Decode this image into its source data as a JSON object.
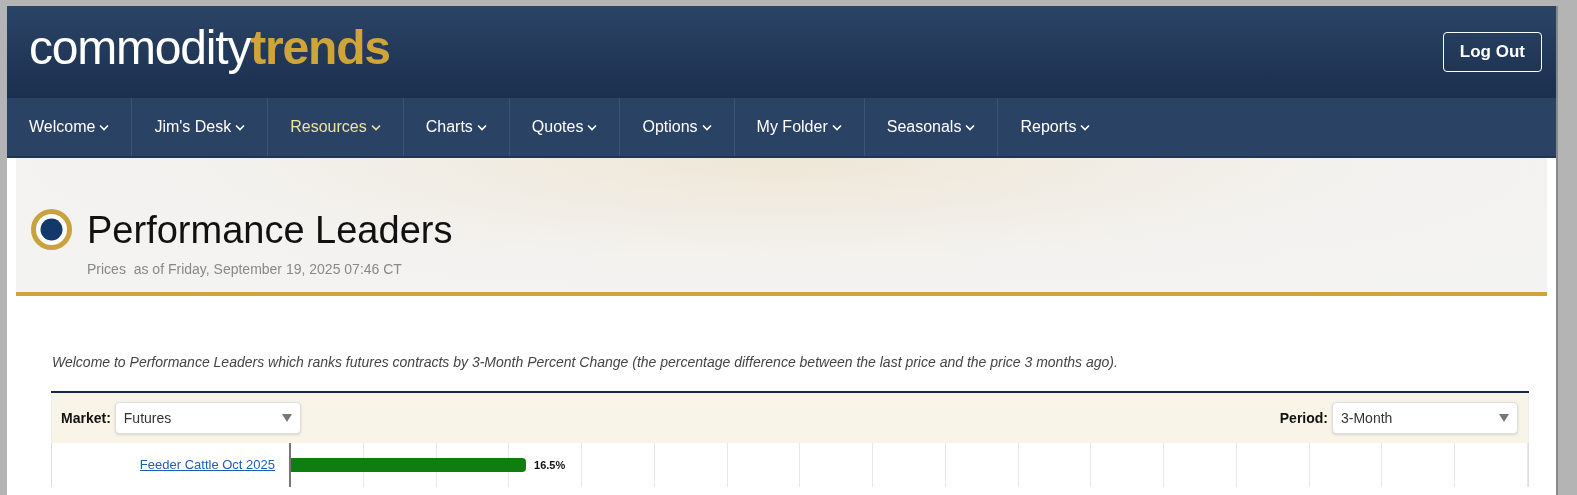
{
  "header": {
    "logo": {
      "part_1": "commodity",
      "part_2": "trends"
    },
    "logout_button": "Log Out"
  },
  "nav": [
    {
      "label": "Welcome",
      "selected": false
    },
    {
      "label": "Jim's Desk",
      "selected": false
    },
    {
      "label": "Resources",
      "selected": true
    },
    {
      "label": "Charts",
      "selected": false
    },
    {
      "label": "Quotes",
      "selected": false
    },
    {
      "label": "Options",
      "selected": false
    },
    {
      "label": "My Folder",
      "selected": false
    },
    {
      "label": "Seasonals",
      "selected": false
    },
    {
      "label": "Reports",
      "selected": false
    }
  ],
  "page": {
    "title": "Performance Leaders",
    "subtitle": "Prices  as of Friday, September 19, 2025 07:46 CT",
    "intro": "Welcome to Performance Leaders which ranks futures contracts by 3-Month Percent Change (the percentage difference between the last price and the price 3 months ago)."
  },
  "filters": {
    "market": {
      "label": "Market:",
      "value": "Futures"
    },
    "period": {
      "label": "Period:",
      "value": "3-Month"
    }
  },
  "leaders": [
    {
      "contract": "Feeder Cattle Oct 2025",
      "level": 0.19,
      "value": "16.5%"
    }
  ]
}
